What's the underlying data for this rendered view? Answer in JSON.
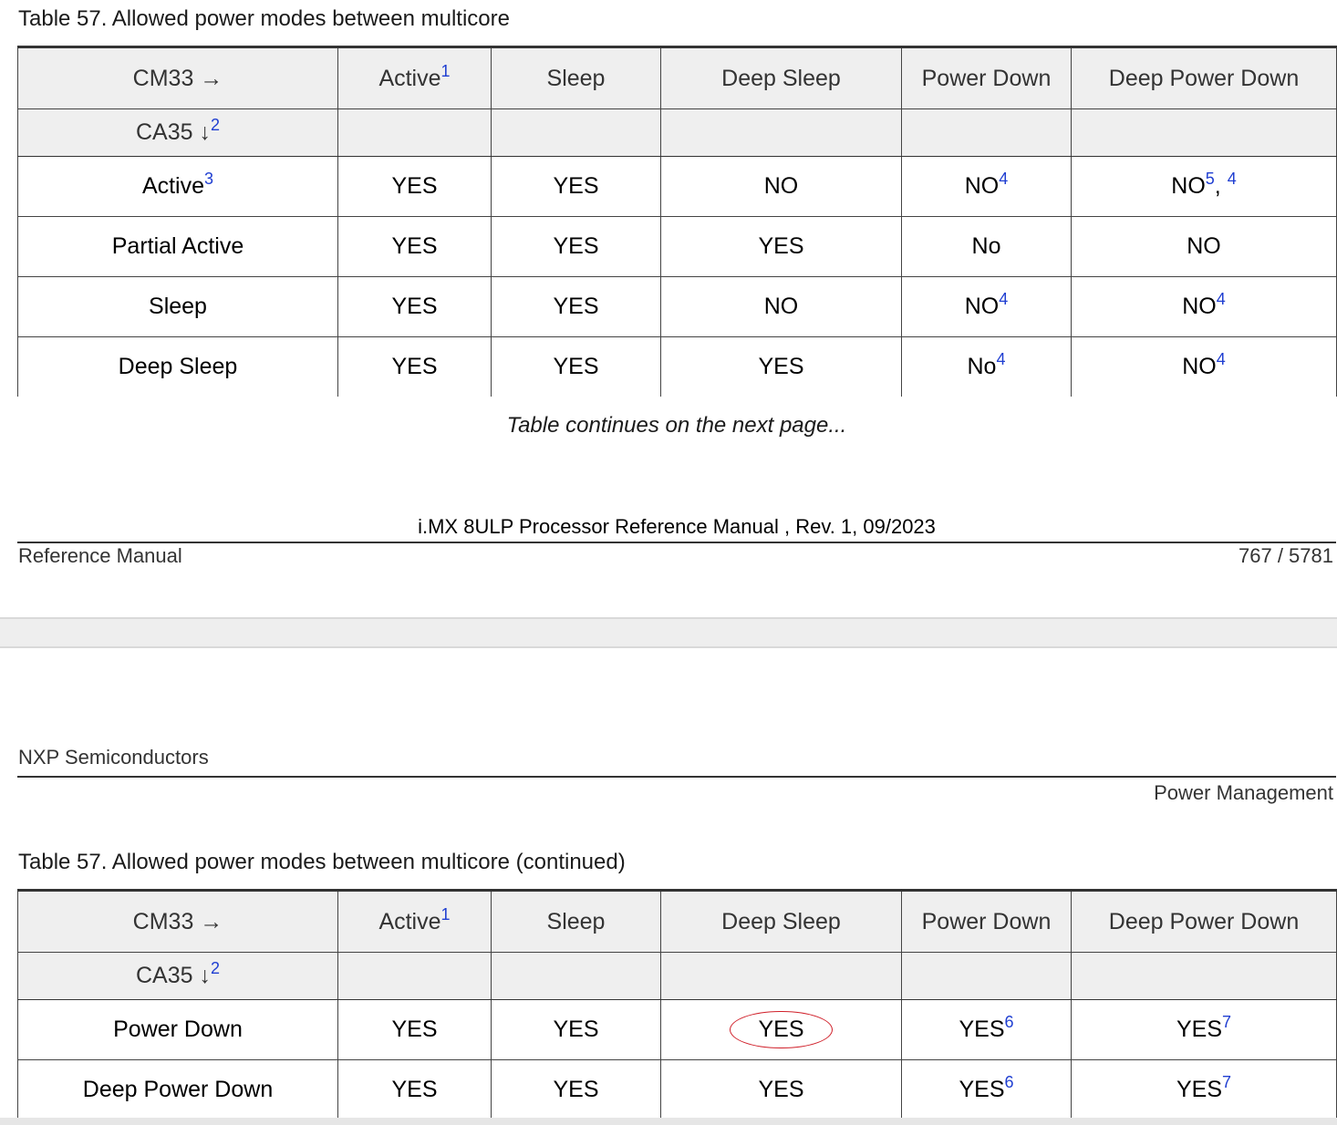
{
  "page1": {
    "caption": "Table 57.  Allowed power modes between multicore",
    "continues": "Table continues on the next page...",
    "footer_title": "i.MX 8ULP Processor Reference Manual , Rev. 1, 09/2023",
    "footer_left": "Reference Manual",
    "footer_right": "767 / 5781",
    "table": {
      "cm33_label": "CM33 →",
      "ca35_label": "CA35 ↓",
      "ca35_ref": "2",
      "col_headers": [
        {
          "label": "Active",
          "ref": "1"
        },
        {
          "label": "Sleep"
        },
        {
          "label": "Deep Sleep"
        },
        {
          "label": "Power Down"
        },
        {
          "label": "Deep Power Down"
        }
      ],
      "rows": [
        {
          "label": "Active",
          "label_ref": "3",
          "cells": [
            {
              "v": "YES"
            },
            {
              "v": "YES"
            },
            {
              "v": "NO"
            },
            {
              "v": "NO",
              "ref": "4"
            },
            {
              "v": "NO",
              "ref": "5",
              "ref2": "4",
              "sep": ", "
            }
          ]
        },
        {
          "label": "Partial Active",
          "cells": [
            {
              "v": "YES"
            },
            {
              "v": "YES"
            },
            {
              "v": "YES"
            },
            {
              "v": "No"
            },
            {
              "v": "NO"
            }
          ]
        },
        {
          "label": "Sleep",
          "cells": [
            {
              "v": "YES"
            },
            {
              "v": "YES"
            },
            {
              "v": "NO"
            },
            {
              "v": "NO",
              "ref": "4"
            },
            {
              "v": "NO",
              "ref": "4"
            }
          ]
        },
        {
          "label": "Deep Sleep",
          "cells": [
            {
              "v": "YES"
            },
            {
              "v": "YES"
            },
            {
              "v": "YES"
            },
            {
              "v": "No",
              "ref": "4"
            },
            {
              "v": "NO",
              "ref": "4"
            }
          ]
        }
      ]
    }
  },
  "page2": {
    "header_left": "NXP Semiconductors",
    "header_right": "Power Management",
    "caption": "Table 57.  Allowed power modes between multicore (continued)",
    "table": {
      "cm33_label": "CM33 →",
      "ca35_label": "CA35 ↓",
      "ca35_ref": "2",
      "col_headers": [
        {
          "label": "Active",
          "ref": "1"
        },
        {
          "label": "Sleep"
        },
        {
          "label": "Deep Sleep"
        },
        {
          "label": "Power Down"
        },
        {
          "label": "Deep Power Down"
        }
      ],
      "rows": [
        {
          "label": "Power Down",
          "cells": [
            {
              "v": "YES"
            },
            {
              "v": "YES"
            },
            {
              "v": "YES"
            },
            {
              "v": "YES",
              "ref": "6"
            },
            {
              "v": "YES",
              "ref": "7"
            }
          ]
        },
        {
          "label": "Deep Power Down",
          "cells": [
            {
              "v": "YES"
            },
            {
              "v": "YES"
            },
            {
              "v": "YES"
            },
            {
              "v": "YES",
              "ref": "6"
            },
            {
              "v": "YES",
              "ref": "7"
            }
          ]
        }
      ]
    }
  },
  "annotation": {
    "color": "#d0202a",
    "shape": "ellipse"
  },
  "colors": {
    "link": "#1f3ed1",
    "header_bg": "#efefef",
    "rule": "#333333"
  }
}
